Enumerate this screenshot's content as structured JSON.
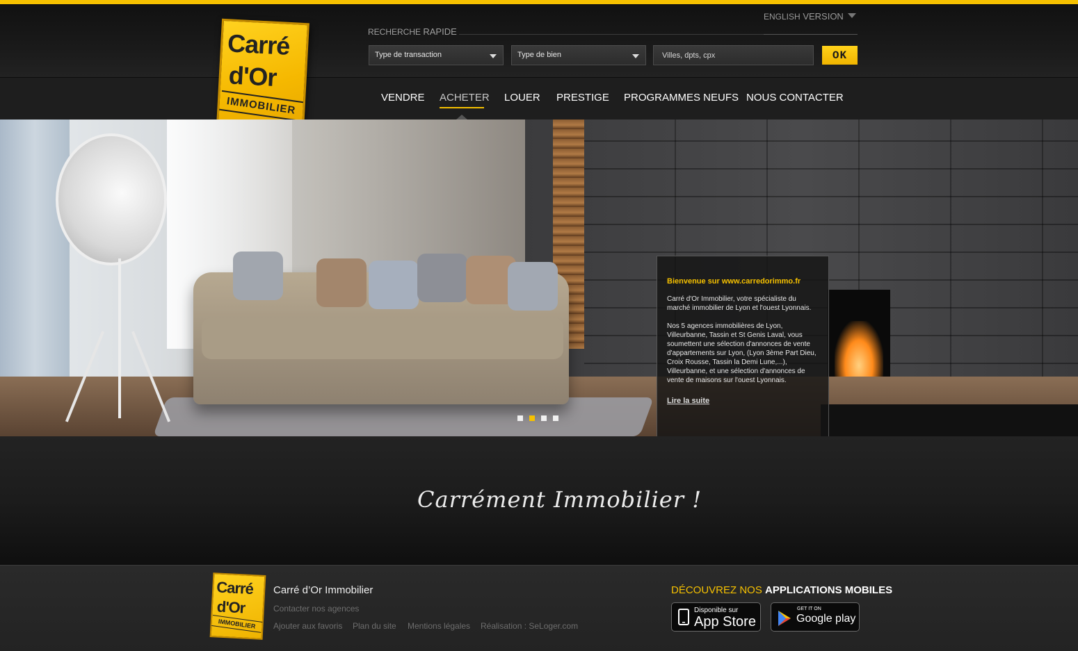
{
  "header": {
    "language_switch": {
      "prefix": "ENGLISH",
      "label": "VERSION"
    },
    "quick_search": {
      "title_prefix": "RECHERCHE",
      "title_suffix": "RAPIDE",
      "transaction_select": "Type de transaction",
      "property_select": "Type de bien",
      "location_placeholder": "Villes, dpts, cpx",
      "submit_label": "OK"
    },
    "logo": {
      "line1": "Carré",
      "line2": "d'Or",
      "line3": "IMMOBILIER"
    }
  },
  "nav": {
    "items": [
      {
        "label": "VENDRE",
        "active": false
      },
      {
        "label": "ACHETER",
        "active": true
      },
      {
        "label": "LOUER",
        "active": false
      },
      {
        "label": "PRESTIGE",
        "active": false
      },
      {
        "label": "PROGRAMMES NEUFS",
        "active": false
      },
      {
        "label": "NOUS CONTACTER",
        "active": false
      }
    ]
  },
  "hero": {
    "slides_count": 4,
    "active_slide": 2,
    "welcome": {
      "title": "Bienvenue sur www.carredorimmo.fr",
      "paragraph1": "Carré d'Or Immobilier, votre spécialiste du marché immobilier de Lyon et l'ouest Lyonnais.",
      "paragraph2": "Nos 5 agences immobilières de Lyon, Villeurbanne, Tassin et St Genis Laval, vous soumettent une sélection d'annonces de vente d'appartements sur Lyon, (Lyon 3ème Part Dieu, Croix Rousse, Tassin la Demi Lune,...), Villeurbanne, et une sélection d'annonces de vente de maisons sur l'ouest Lyonnais.",
      "read_more": "Lire la suite"
    }
  },
  "tagline": "Carrément Immobilier !",
  "footer": {
    "logo": {
      "line1": "Carré",
      "line2": "d'Or",
      "line3": "IMMOBILIER"
    },
    "company_name": "Carré d’Or Immobilier",
    "contact_link": "Contacter nos agences",
    "links": [
      "Ajouter aux favoris",
      "Plan du site",
      "Mentions légales",
      "Réalisation : SeLoger.com"
    ],
    "apps_title_prefix": "DÉCOUVREZ NOS",
    "apps_title_highlight": "APPLICATIONS MOBILES",
    "app_store": {
      "small": "Disponible sur",
      "big": "App Store",
      "icon": "apple-icon"
    },
    "google_play": {
      "small": "GET IT ON",
      "big": "Google play",
      "icon": "google-play-icon"
    }
  },
  "colors": {
    "accent": "#f6c100",
    "background": "#1c1c1c"
  }
}
